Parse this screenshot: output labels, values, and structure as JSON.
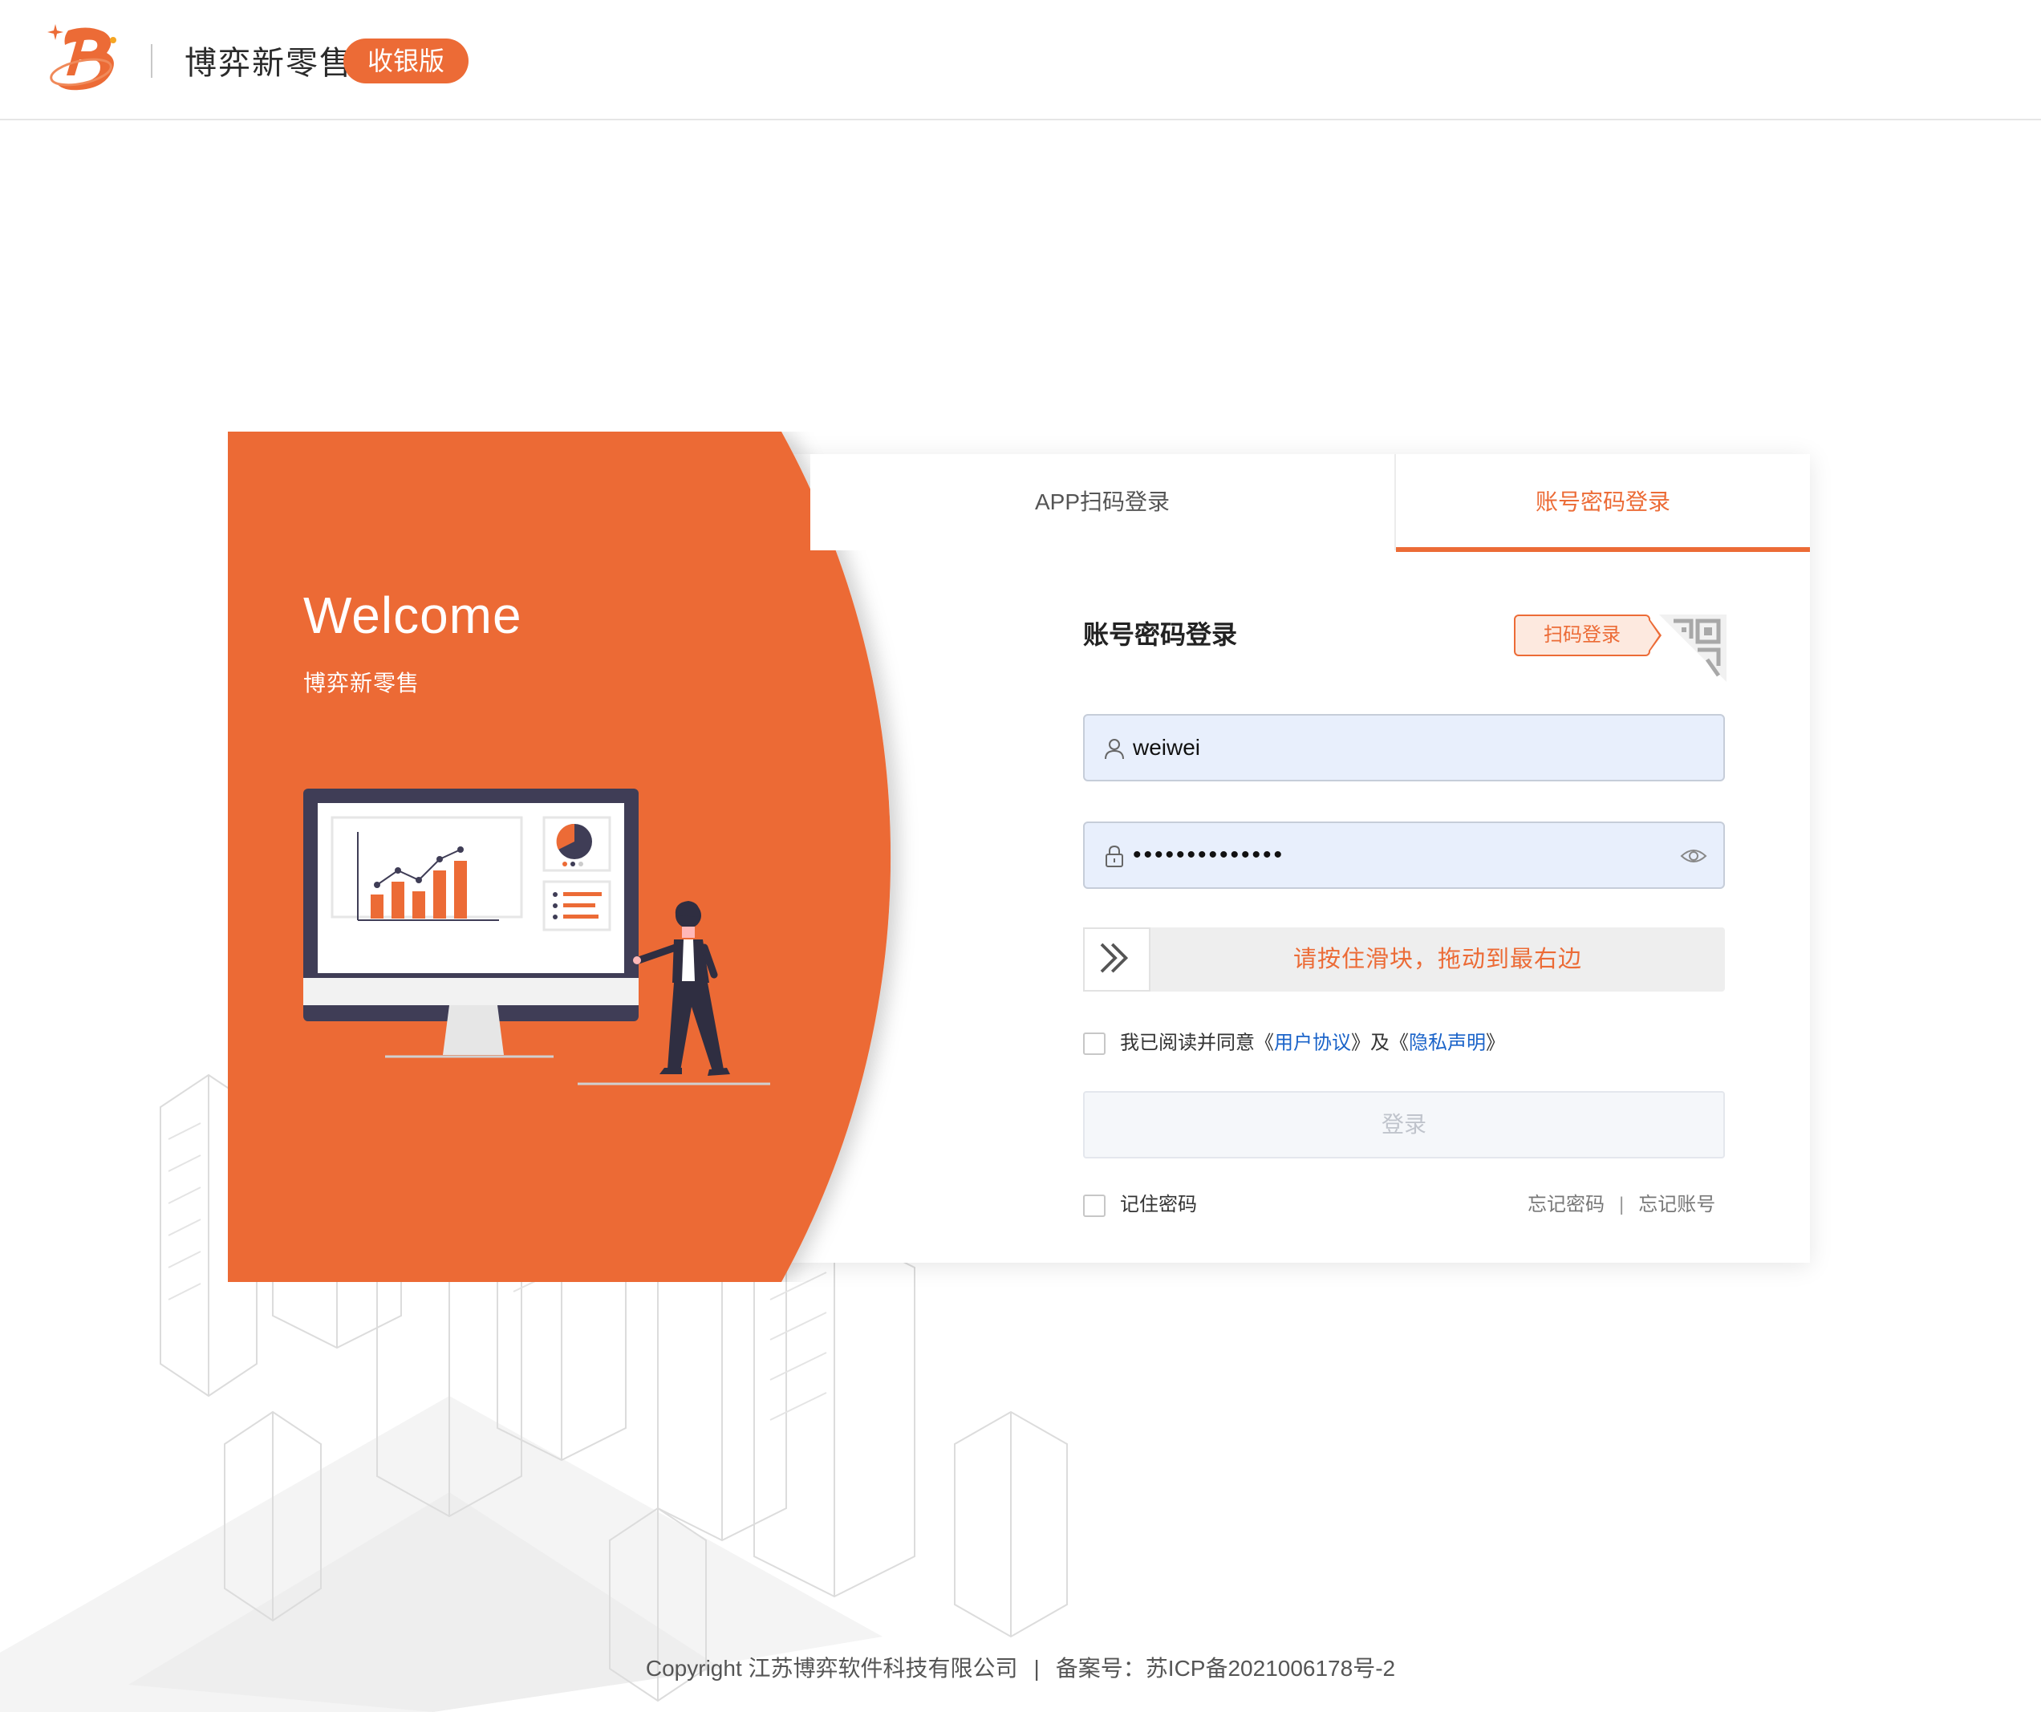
{
  "header": {
    "brand": "博弈新零售",
    "edition": "收银版"
  },
  "welcome": {
    "title": "Welcome",
    "subtitle": "博弈新零售"
  },
  "tabs": {
    "app_scan": "APP扫码登录",
    "account": "账号密码登录"
  },
  "form": {
    "title": "账号密码登录",
    "scan_button": "扫码登录",
    "username": "weiwei",
    "password_masked": "••••••••••••••",
    "slider_text": "请按住滑块，拖动到最右边",
    "agree_prefix": "我已阅读并同意《",
    "user_agreement": "用户协议",
    "agree_mid": "》及《",
    "privacy": "隐私声明",
    "agree_suffix": "》",
    "login_button": "登录",
    "remember": "记住密码",
    "forgot_password": "忘记密码",
    "forgot_separator": "|",
    "forgot_account": "忘记账号"
  },
  "footer": {
    "copyright": "Copyright 江苏博弈软件科技有限公司",
    "separator": "|",
    "icp": "备案号：苏ICP备2021006178号-2"
  },
  "colors": {
    "accent": "#ec6b36",
    "link": "#1a63c9",
    "input_bg": "#e8effc"
  }
}
